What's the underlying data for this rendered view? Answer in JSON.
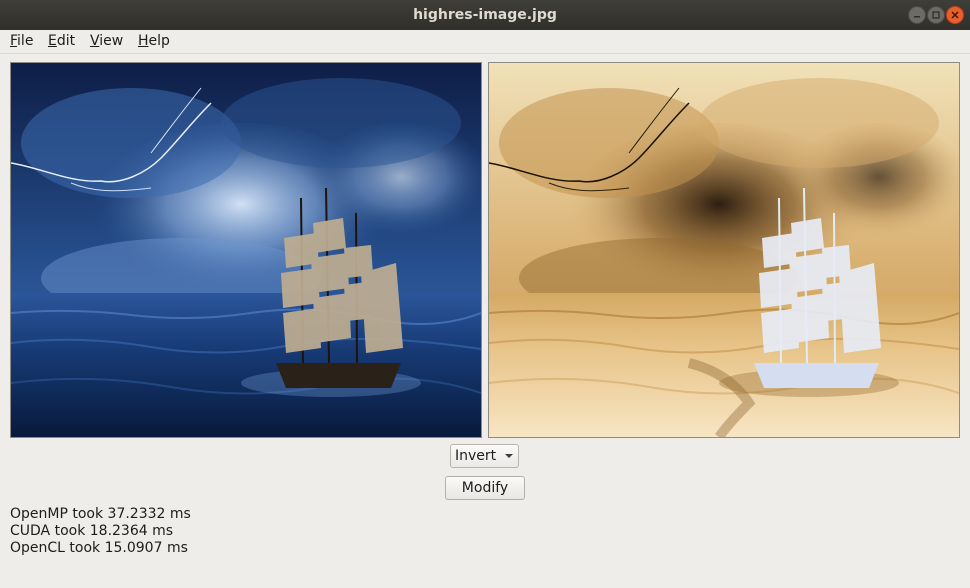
{
  "window": {
    "title": "highres-image.jpg"
  },
  "menubar": {
    "items": [
      {
        "accel": "F",
        "rest": "ile"
      },
      {
        "accel": "E",
        "rest": "dit"
      },
      {
        "accel": "V",
        "rest": "iew"
      },
      {
        "accel": "H",
        "rest": "elp"
      }
    ]
  },
  "images": {
    "original": {
      "icon": "ship-storm-image",
      "tone": "#1c3d78"
    },
    "processed": {
      "icon": "ship-storm-inverted-image",
      "tone": "#d9b483"
    }
  },
  "controls": {
    "filter_selected": "Invert",
    "modify_label": "Modify"
  },
  "timings": [
    "OpenMP took 37.2332 ms",
    "CUDA took 18.2364 ms",
    "OpenCL took 15.0907 ms"
  ],
  "colors": {
    "close_button": "#e85f2c",
    "titlebar": "#3a3935"
  }
}
